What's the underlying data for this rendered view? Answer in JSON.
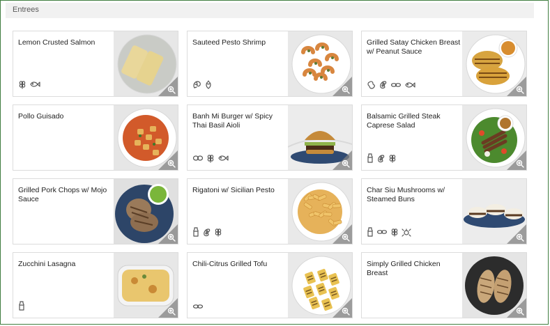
{
  "section": {
    "title": "Entrees"
  },
  "items": [
    {
      "name": "Lemon Crusted Salmon",
      "icons": [
        "wheat-icon",
        "fish-icon"
      ]
    },
    {
      "name": "Sauteed Pesto Shrimp",
      "icons": [
        "shrimp-icon",
        "tree-nut-icon"
      ]
    },
    {
      "name": "Grilled Satay Chicken Breast w/ Peanut Sauce",
      "icons": [
        "peanut-icon",
        "soy-icon",
        "sesame-icon",
        "fish-icon"
      ]
    },
    {
      "name": "Pollo Guisado",
      "icons": []
    },
    {
      "name": "Banh Mi Burger w/ Spicy Thai Basil Aioli",
      "icons": [
        "egg-icon",
        "wheat-icon",
        "fish-icon"
      ]
    },
    {
      "name": "Balsamic Grilled Steak Caprese Salad",
      "icons": [
        "milk-icon",
        "soy-icon",
        "wheat-icon"
      ]
    },
    {
      "name": "Grilled Pork Chops w/ Mojo Sauce",
      "icons": []
    },
    {
      "name": "Rigatoni w/ Sicilian Pesto",
      "icons": [
        "milk-icon",
        "soy-icon",
        "wheat-icon"
      ]
    },
    {
      "name": "Char Siu Mushrooms w/ Steamed Buns",
      "icons": [
        "milk-icon",
        "sesame-icon",
        "wheat-icon",
        "shellfish-icon"
      ]
    },
    {
      "name": "Zucchini Lasagna",
      "icons": [
        "milk-icon"
      ]
    },
    {
      "name": "Chili-Citrus Grilled Tofu",
      "icons": [
        "sesame-icon"
      ]
    },
    {
      "name": "Simply Grilled Chicken Breast",
      "icons": []
    }
  ]
}
